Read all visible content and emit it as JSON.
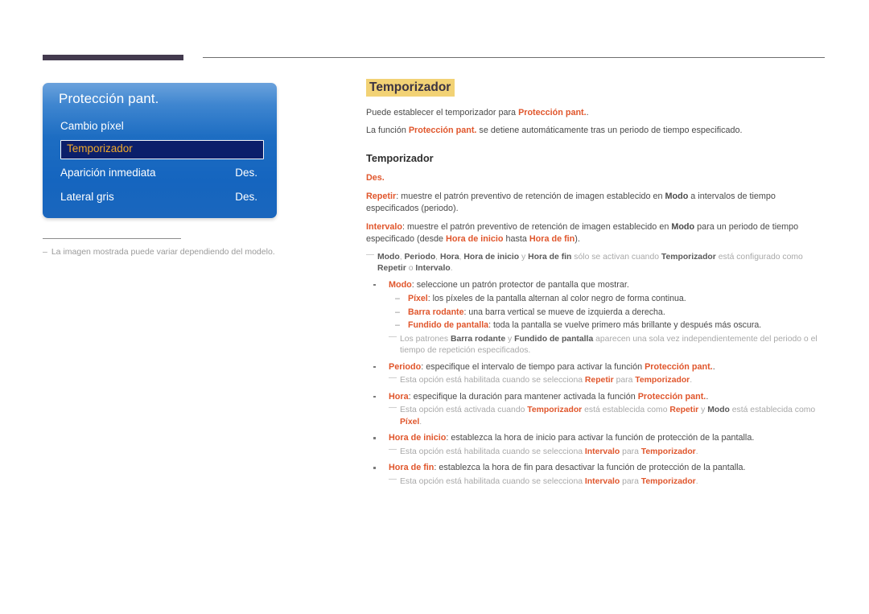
{
  "header": {
    "bar_color": "#433a4e",
    "rule_color": "#6e6e6e"
  },
  "osd": {
    "title": "Protección pant.",
    "selected_index": 1,
    "accent_text_color": "#f0a92a",
    "selected_bg_color": "#0b1f6b",
    "panel_color": "#1565bf",
    "rows": [
      {
        "label": "Cambio píxel",
        "value": ""
      },
      {
        "label": "Temporizador",
        "value": ""
      },
      {
        "label": "Aparición inmediata",
        "value": "Des."
      },
      {
        "label": "Lateral gris",
        "value": "Des."
      }
    ]
  },
  "footnote": {
    "dash": "–",
    "text": "La imagen mostrada puede variar dependiendo del modelo."
  },
  "doc": {
    "title": "Temporizador",
    "title_highlight_color": "#f2d275",
    "intro": [
      {
        "parts": [
          {
            "t": "Puede establecer el temporizador para ",
            "s": "n"
          },
          {
            "t": "Protección pant.",
            "s": "r"
          },
          {
            "t": ".",
            "s": "n"
          }
        ]
      },
      {
        "parts": [
          {
            "t": "La función ",
            "s": "n"
          },
          {
            "t": "Protección pant.",
            "s": "r"
          },
          {
            "t": " se detiene automáticamente tras un periodo de tiempo especificado.",
            "s": "n"
          }
        ]
      }
    ],
    "section_heading": "Temporizador",
    "blocks": [
      {
        "type": "def",
        "parts": [
          {
            "t": "Des.",
            "s": "r"
          }
        ]
      },
      {
        "type": "def",
        "parts": [
          {
            "t": "Repetir",
            "s": "r"
          },
          {
            "t": ": muestre el patrón preventivo de retención de imagen establecido en ",
            "s": "n"
          },
          {
            "t": "Modo",
            "s": "k"
          },
          {
            "t": " a intervalos de tiempo especificados (periodo).",
            "s": "n"
          }
        ]
      },
      {
        "type": "def",
        "parts": [
          {
            "t": "Intervalo",
            "s": "r"
          },
          {
            "t": ": muestre el patrón preventivo de retención de imagen establecido en ",
            "s": "n"
          },
          {
            "t": "Modo",
            "s": "k"
          },
          {
            "t": " para un periodo de tiempo especificado (desde ",
            "s": "n"
          },
          {
            "t": "Hora de inicio",
            "s": "r"
          },
          {
            "t": " hasta ",
            "s": "n"
          },
          {
            "t": "Hora de fin",
            "s": "r"
          },
          {
            "t": ").",
            "s": "n"
          }
        ]
      },
      {
        "type": "note",
        "level": 0,
        "parts": [
          {
            "t": "Modo",
            "s": "k"
          },
          {
            "t": ", ",
            "s": "n"
          },
          {
            "t": "Periodo",
            "s": "k"
          },
          {
            "t": ", ",
            "s": "n"
          },
          {
            "t": "Hora",
            "s": "k"
          },
          {
            "t": ", ",
            "s": "n"
          },
          {
            "t": "Hora de inicio",
            "s": "k"
          },
          {
            "t": " y ",
            "s": "n"
          },
          {
            "t": "Hora de fin",
            "s": "k"
          },
          {
            "t": " sólo se activan cuando ",
            "s": "n"
          },
          {
            "t": "Temporizador",
            "s": "k"
          },
          {
            "t": " está configurado como ",
            "s": "n"
          },
          {
            "t": "Repetir",
            "s": "k"
          },
          {
            "t": " o ",
            "s": "n"
          },
          {
            "t": "Intervalo",
            "s": "k"
          },
          {
            "t": ".",
            "s": "n"
          }
        ]
      },
      {
        "type": "b1",
        "parts": [
          {
            "t": "Modo",
            "s": "r"
          },
          {
            "t": ": seleccione un patrón protector de pantalla que mostrar.",
            "s": "n"
          }
        ]
      },
      {
        "type": "b2",
        "parts": [
          {
            "t": "Píxel",
            "s": "r"
          },
          {
            "t": ": los píxeles de la pantalla alternan al color negro de forma continua.",
            "s": "n"
          }
        ]
      },
      {
        "type": "b2",
        "parts": [
          {
            "t": "Barra rodante",
            "s": "r"
          },
          {
            "t": ": una barra vertical se mueve de izquierda a derecha.",
            "s": "n"
          }
        ]
      },
      {
        "type": "b2",
        "parts": [
          {
            "t": "Fundido de pantalla",
            "s": "r"
          },
          {
            "t": ": toda la pantalla se vuelve primero más brillante y después más oscura.",
            "s": "n"
          }
        ]
      },
      {
        "type": "note",
        "level": 1,
        "parts": [
          {
            "t": "Los patrones ",
            "s": "n"
          },
          {
            "t": "Barra rodante",
            "s": "k"
          },
          {
            "t": " y ",
            "s": "n"
          },
          {
            "t": "Fundido de pantalla",
            "s": "k"
          },
          {
            "t": " aparecen una sola vez independientemente del periodo o el tiempo de repetición especificados.",
            "s": "n"
          }
        ]
      },
      {
        "type": "b1",
        "parts": [
          {
            "t": "Periodo",
            "s": "r"
          },
          {
            "t": ": especifique el intervalo de tiempo para activar la función ",
            "s": "n"
          },
          {
            "t": "Protección pant.",
            "s": "r"
          },
          {
            "t": ".",
            "s": "n"
          }
        ]
      },
      {
        "type": "note",
        "level": 1,
        "parts": [
          {
            "t": "Esta opción está habilitada cuando se selecciona ",
            "s": "n"
          },
          {
            "t": "Repetir",
            "s": "r"
          },
          {
            "t": " para ",
            "s": "n"
          },
          {
            "t": "Temporizador",
            "s": "r"
          },
          {
            "t": ".",
            "s": "n"
          }
        ]
      },
      {
        "type": "b1",
        "parts": [
          {
            "t": "Hora",
            "s": "r"
          },
          {
            "t": ": especifique la duración para mantener activada la función ",
            "s": "n"
          },
          {
            "t": "Protección pant.",
            "s": "r"
          },
          {
            "t": ".",
            "s": "n"
          }
        ]
      },
      {
        "type": "note",
        "level": 1,
        "parts": [
          {
            "t": "Esta opción está activada cuando ",
            "s": "n"
          },
          {
            "t": "Temporizador",
            "s": "r"
          },
          {
            "t": " está establecida como ",
            "s": "n"
          },
          {
            "t": "Repetir",
            "s": "r"
          },
          {
            "t": " y ",
            "s": "n"
          },
          {
            "t": "Modo",
            "s": "k"
          },
          {
            "t": " está establecida como ",
            "s": "n"
          },
          {
            "t": "Píxel",
            "s": "r"
          },
          {
            "t": ".",
            "s": "n"
          }
        ]
      },
      {
        "type": "b1",
        "parts": [
          {
            "t": "Hora de inicio",
            "s": "r"
          },
          {
            "t": ": establezca la hora de inicio para activar la función de protección de la pantalla.",
            "s": "n"
          }
        ]
      },
      {
        "type": "note",
        "level": 1,
        "parts": [
          {
            "t": "Esta opción está habilitada cuando se selecciona ",
            "s": "n"
          },
          {
            "t": "Intervalo",
            "s": "r"
          },
          {
            "t": " para ",
            "s": "n"
          },
          {
            "t": "Temporizador",
            "s": "r"
          },
          {
            "t": ".",
            "s": "n"
          }
        ]
      },
      {
        "type": "b1",
        "parts": [
          {
            "t": "Hora de fin",
            "s": "r"
          },
          {
            "t": ": establezca la hora de fin para desactivar la función de protección de la pantalla.",
            "s": "n"
          }
        ]
      },
      {
        "type": "note",
        "level": 1,
        "parts": [
          {
            "t": "Esta opción está habilitada cuando se selecciona ",
            "s": "n"
          },
          {
            "t": "Intervalo",
            "s": "r"
          },
          {
            "t": " para ",
            "s": "n"
          },
          {
            "t": "Temporizador",
            "s": "r"
          },
          {
            "t": ".",
            "s": "n"
          }
        ]
      }
    ]
  }
}
